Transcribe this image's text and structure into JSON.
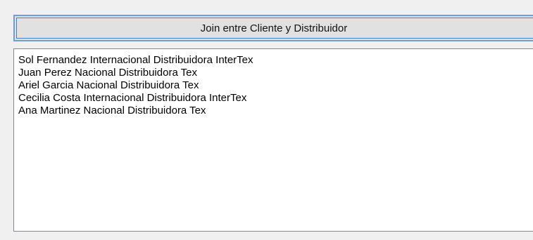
{
  "join_button": {
    "label": "Join entre Cliente y Distribuidor"
  },
  "listbox": {
    "items": [
      "Sol Fernandez Internacional Distribuidora InterTex",
      "Juan Perez Nacional Distribuidora Tex",
      "Ariel Garcia Nacional Distribuidora Tex",
      "Cecilia Costa Internacional Distribuidora InterTex",
      "Ana Martinez Nacional Distribuidora Tex"
    ]
  }
}
